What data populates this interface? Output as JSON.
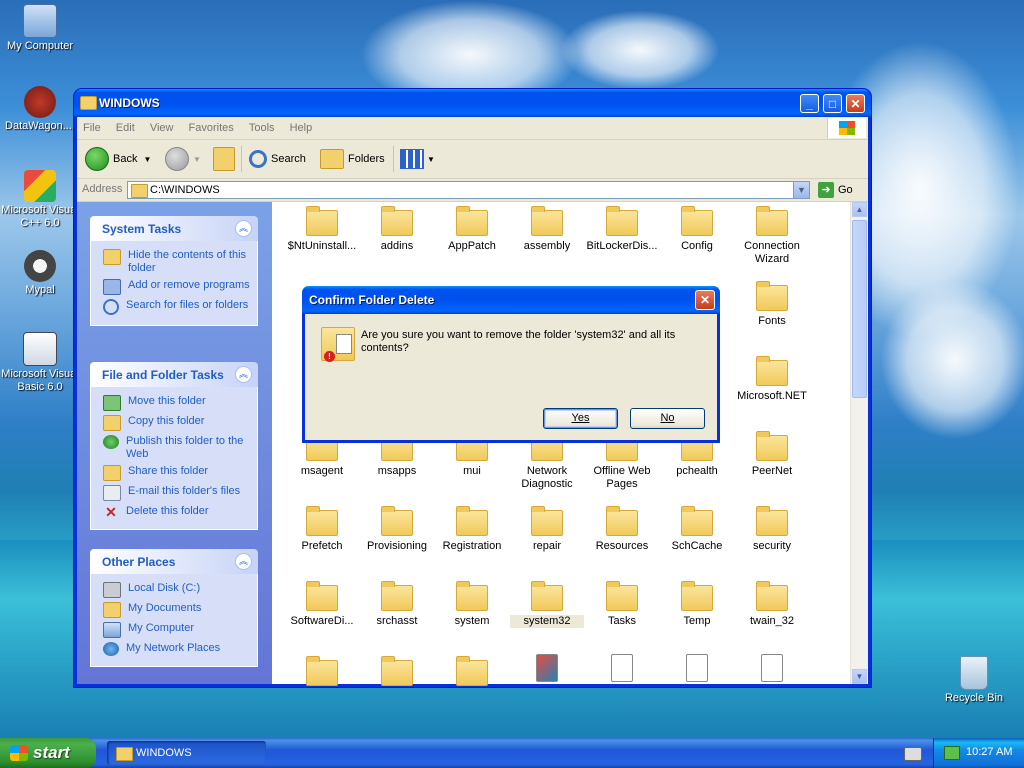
{
  "desktop": {
    "icons": [
      {
        "label": "My Computer"
      },
      {
        "label": "DataWagon...."
      },
      {
        "label": "Microsoft Visual C++ 6.0"
      },
      {
        "label": "Mypal"
      },
      {
        "label": "Microsoft Visual Basic 6.0"
      },
      {
        "label": "Recycle Bin"
      }
    ]
  },
  "window": {
    "title": "WINDOWS",
    "menu": [
      "File",
      "Edit",
      "View",
      "Favorites",
      "Tools",
      "Help"
    ],
    "toolbar": {
      "back": "Back",
      "search": "Search",
      "folders": "Folders"
    },
    "address": {
      "label": "Address",
      "value": "C:\\WINDOWS",
      "go": "Go"
    },
    "taskpane": {
      "system_tasks": {
        "title": "System Tasks",
        "items": [
          "Hide the contents of this folder",
          "Add or remove programs",
          "Search for files or folders"
        ]
      },
      "file_folder_tasks": {
        "title": "File and Folder Tasks",
        "items": [
          "Move this folder",
          "Copy this folder",
          "Publish this folder to the Web",
          "Share this folder",
          "E-mail this folder's files",
          "Delete this folder"
        ]
      },
      "other_places": {
        "title": "Other Places",
        "items": [
          "Local Disk (C:)",
          "My Documents",
          "My Computer",
          "My Network Places"
        ]
      }
    },
    "files": [
      "$NtUninstall...",
      "addins",
      "AppPatch",
      "assembly",
      "BitLockerDis...",
      "Config",
      "Connection Wizard",
      "Fonts",
      "Microsoft.NET",
      "msagent",
      "msapps",
      "mui",
      "Network Diagnostic",
      "Offline Web Pages",
      "pchealth",
      "PeerNet",
      "Prefetch",
      "Provisioning",
      "Registration",
      "repair",
      "Resources",
      "SchCache",
      "security",
      "SoftwareDi...",
      "srchasst",
      "system",
      "system32",
      "Tasks",
      "Temp",
      "twain_32"
    ]
  },
  "dialog": {
    "title": "Confirm Folder Delete",
    "message": "Are you sure you want to remove the folder 'system32' and all its contents?",
    "yes": "Yes",
    "no": "No"
  },
  "taskbar": {
    "start": "start",
    "task": "WINDOWS",
    "clock": "10:27 AM"
  }
}
